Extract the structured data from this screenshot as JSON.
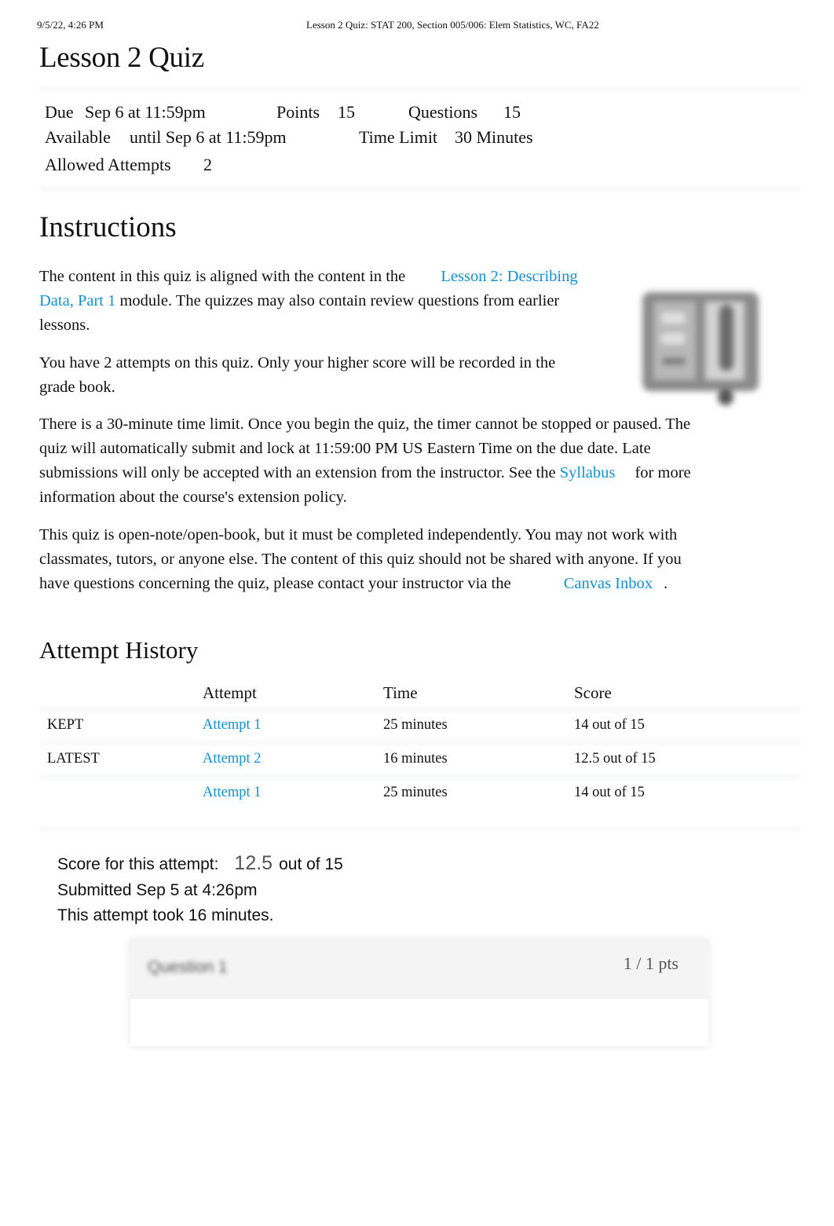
{
  "print_header": {
    "datetime": "9/5/22, 4:26 PM",
    "document_title": "Lesson 2 Quiz: STAT 200, Section 005/006: Elem Statistics, WC, FA22"
  },
  "quiz": {
    "title": "Lesson 2 Quiz",
    "details": {
      "due_label": "Due",
      "due_value": "Sep 6 at 11:59pm",
      "points_label": "Points",
      "points_value": "15",
      "questions_label": "Questions",
      "questions_value": "15",
      "available_label": "Available",
      "available_value": "until Sep 6 at 11:59pm",
      "time_limit_label": "Time Limit",
      "time_limit_value": "30 Minutes",
      "allowed_attempts_label": "Allowed Attempts",
      "allowed_attempts_value": "2"
    }
  },
  "instructions": {
    "heading": "Instructions",
    "p1_before": "The content in this quiz is aligned with the content in the ",
    "p1_link": "Lesson 2: Describing Data, Part 1",
    "p1_after": " module. The quizzes may also contain review questions from earlier lessons.",
    "p2": "You have 2 attempts on this quiz. Only your higher score will be recorded in the grade book.",
    "p3_before": "There is a 30-minute time limit. Once you begin the quiz, the timer cannot be stopped or paused. The quiz will automatically submit and lock at 11:59:00 PM US Eastern Time on the due date. Late submissions will only be accepted with an extension from the instructor. See the ",
    "p3_link": "Syllabus",
    "p3_after": " for more information about the course's extension policy.",
    "p4_before": "This quiz is open-note/open-book, but it must be completed independently. You may not work with classmates, tutors, or anyone else. The content of this quiz should not be shared with anyone. If you have questions concerning the quiz, please contact your instructor via the ",
    "p4_link": "Canvas Inbox",
    "p4_after": ".",
    "image_icon": "book-icon"
  },
  "attempt_history": {
    "heading": "Attempt History",
    "columns": [
      "",
      "Attempt",
      "Time",
      "Score"
    ],
    "rows": [
      {
        "status": "KEPT",
        "attempt": "Attempt 1",
        "time": "25 minutes",
        "score": "14 out of 15"
      },
      {
        "status": "LATEST",
        "attempt": "Attempt 2",
        "time": "16 minutes",
        "score": "12.5 out of 15"
      },
      {
        "status": "",
        "attempt": "Attempt 1",
        "time": "25 minutes",
        "score": "14 out of 15"
      }
    ]
  },
  "attempt_summary": {
    "score_label": "Score for this attempt:",
    "score_value": "12.5",
    "score_suffix": "out of 15",
    "submitted": "Submitted Sep 5 at 4:26pm",
    "duration": "This attempt took 16 minutes."
  },
  "question_card": {
    "title": "Question 1",
    "points": "1 / 1 pts"
  },
  "colors": {
    "link": "#1591d6",
    "text": "#111111",
    "card_header": "#f4f4f4"
  }
}
